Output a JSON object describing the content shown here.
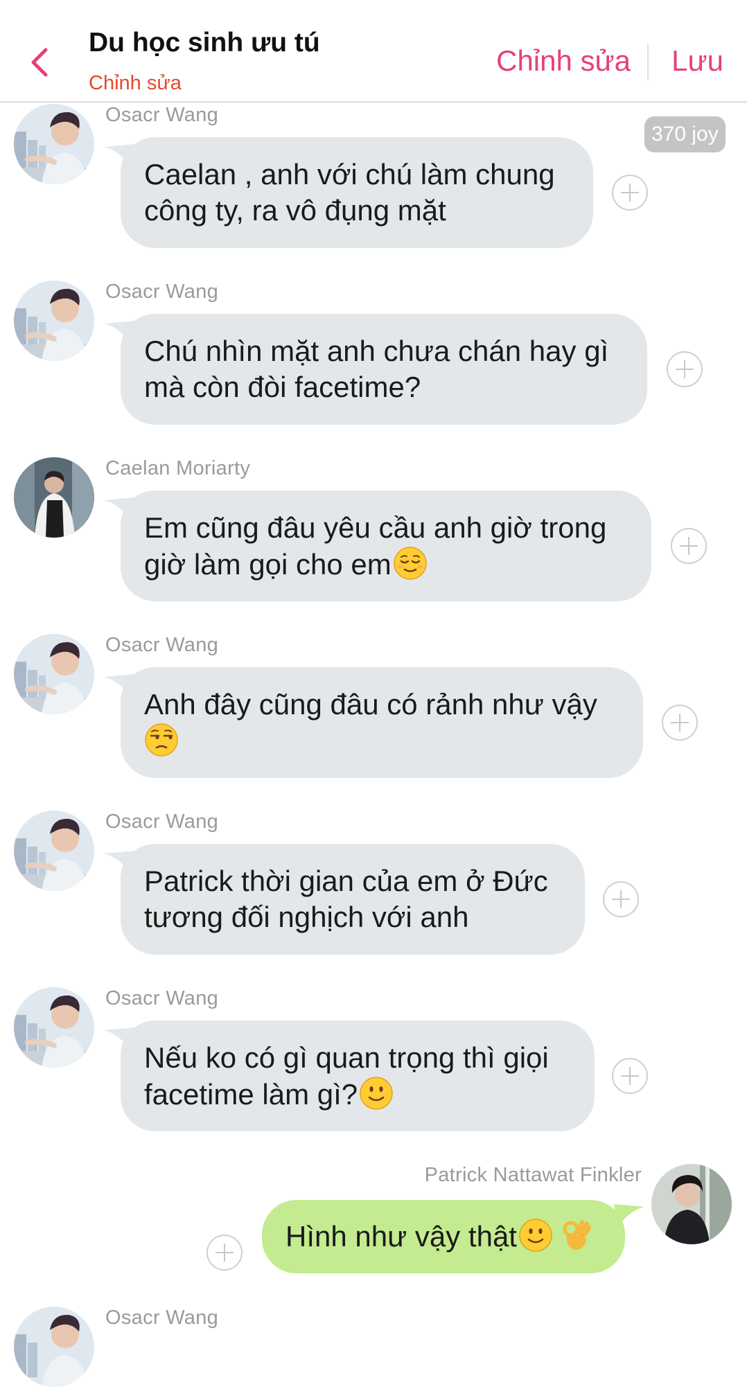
{
  "header": {
    "title": "Du học sinh ưu tú",
    "subtitle": "Chỉnh sửa",
    "edit_label": "Chỉnh sửa",
    "save_label": "Lưu"
  },
  "badge": {
    "joy": "370 joy"
  },
  "messages": [
    {
      "sender": "Osacr Wang",
      "line1": "Caelan , anh với chú làm chung",
      "line2": "công ty, ra vô đụng mặt"
    },
    {
      "sender": "Osacr Wang",
      "line1": "Chú nhìn mặt anh chưa chán hay gì",
      "line2": "mà còn đòi facetime?"
    },
    {
      "sender": "Caelan Moriarty",
      "line1": "Em cũng đâu yêu cầu anh giờ trong",
      "line2": "giờ làm gọi cho em",
      "emoji": "relieved-face"
    },
    {
      "sender": "Osacr Wang",
      "line1": "Anh đây cũng đâu có rảnh như vậy",
      "line2": "",
      "emoji": "unamused-face"
    },
    {
      "sender": "Osacr Wang",
      "line1": "Patrick thời gian của em ở Đức",
      "line2": "tương đối nghịch với anh"
    },
    {
      "sender": "Osacr Wang",
      "line1": "Nếu ko có gì quan trọng thì giọi",
      "line2": "facetime làm gì?",
      "emoji": "slightly-smiling-face"
    },
    {
      "sender": "Patrick Nattawat Finkler",
      "line1": "Hình như vậy thật",
      "emojis": [
        "slightly-smiling-face",
        "ok-hand"
      ]
    },
    {
      "sender": "Osacr Wang"
    }
  ],
  "colors": {
    "accent": "#e5407f",
    "subtitle": "#e34a2c",
    "bubble_other": "#e4e7ea",
    "bubble_mine": "#c4eb8f",
    "name_gray": "#9a9a9a"
  }
}
